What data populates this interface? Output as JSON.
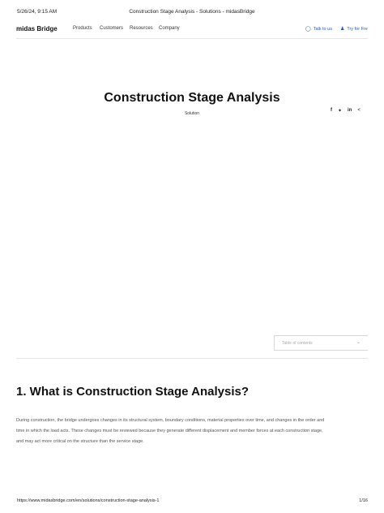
{
  "print_header": {
    "datetime": "5/26/24, 9:15 AM",
    "doc_title": "Construction Stage Analysis - Solutions - midasBridge"
  },
  "nav": {
    "brand": "midas Bridge",
    "menu": [
      "Products",
      "Customers",
      "Resources",
      "Company"
    ],
    "talk_label": "Talk to us",
    "try_label": "Try for Fre"
  },
  "hero": {
    "title": "Construction Stage Analysis",
    "subtitle": "Solution"
  },
  "share": {
    "facebook": "f",
    "twitter": "✦",
    "linkedin": "in",
    "share": "<"
  },
  "toc": {
    "label": "Table of contents"
  },
  "section": {
    "heading": "1. What is Construction Stage Analysis?",
    "lines": [
      "During construction, the bridge undergoes changes in its structural system, boundary conditions, material properties over time, and changes in the order and",
      "time in which the load acts. These changes must be reviewed because they generate different displacement and member forces at each construction stage,",
      "and may act more critical on the structure than the service stage."
    ]
  },
  "print_footer": {
    "url": "https://www.midasbridge.com/en/solutions/construction-stage-analysis-1",
    "page": "1/16"
  }
}
